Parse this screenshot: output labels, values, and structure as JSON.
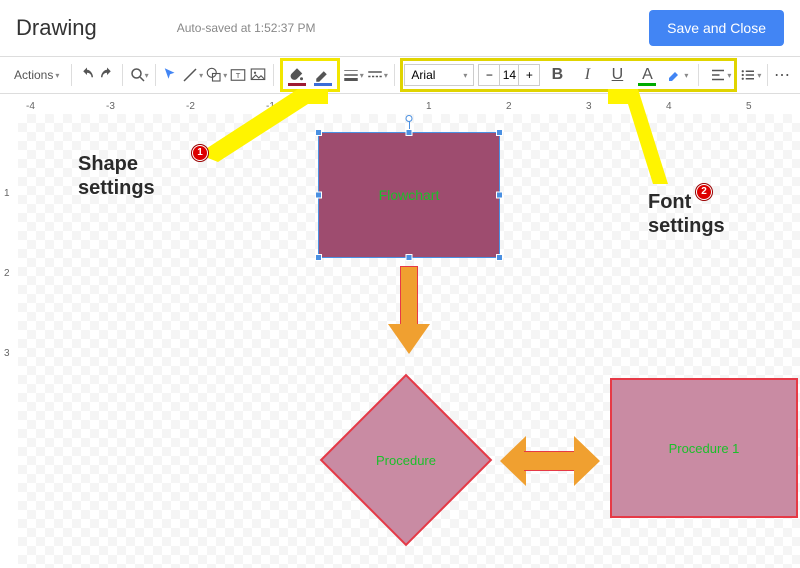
{
  "header": {
    "title": "Drawing",
    "autosave": "Auto-saved at 1:52:37 PM",
    "save_button": "Save and Close"
  },
  "toolbar": {
    "actions": "Actions",
    "font_name": "Arial",
    "font_size": "14"
  },
  "ruler": {
    "h": [
      "-4",
      "-3",
      "-2",
      "-1",
      "1",
      "2",
      "3",
      "4",
      "5"
    ],
    "v": [
      "1",
      "2",
      "3"
    ]
  },
  "shapes": {
    "rect1": "Flowchart",
    "diamond": "Procedure",
    "rect2": "Procedure 1"
  },
  "annotations": {
    "left_label_l1": "Shape",
    "left_label_l2": "settings",
    "right_label_l1": "Font",
    "right_label_l2": "settings",
    "badge1": "1",
    "badge2": "2"
  }
}
